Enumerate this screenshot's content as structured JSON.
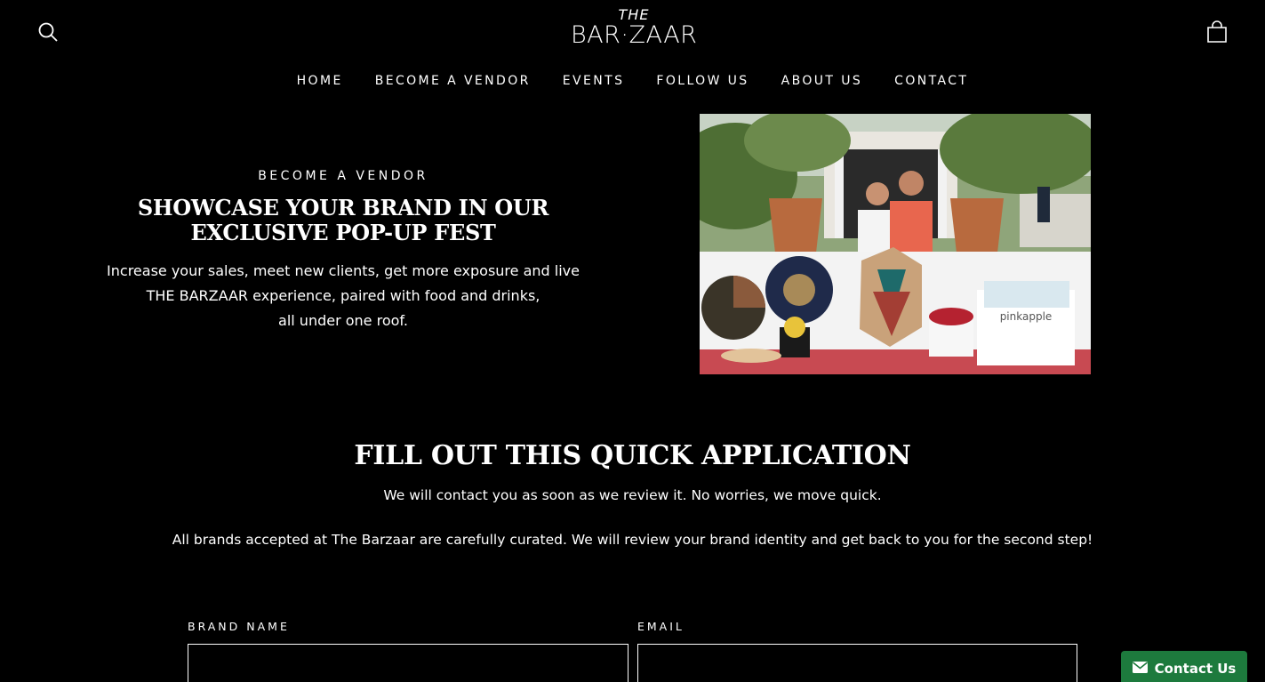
{
  "header": {
    "logo": {
      "the": "THE",
      "name": "BAR·ZAAR"
    },
    "search_icon": "search-icon",
    "cart_icon": "cart-icon"
  },
  "nav": {
    "items": [
      "HOME",
      "BECOME A VENDOR",
      "EVENTS",
      "FOLLOW US",
      "ABOUT US",
      "CONTACT"
    ]
  },
  "hero": {
    "eyebrow": "BECOME A VENDOR",
    "title_line1": "SHOWCASE YOUR BRAND IN OUR",
    "title_line2": "EXCLUSIVE POP-UP FEST",
    "body_line1": "Increase your sales, meet new clients, get more exposure and live",
    "body_line2": "THE BARZAAR experience, paired with food and drinks,",
    "body_line3": "all under one roof.",
    "photo_sign": "pinkapple"
  },
  "application": {
    "title": "FILL OUT THIS QUICK APPLICATION",
    "subtitle": "We will contact you as soon as we review it. No worries, we move quick.",
    "note": "All brands accepted at The Barzaar are carefully curated. We will review your brand identity and get back to you for the second step!",
    "fields": {
      "brand_label": "BRAND NAME",
      "brand_value": "",
      "email_label": "EMAIL",
      "email_value": ""
    }
  },
  "contact_widget": {
    "label": "Contact Us",
    "icon": "envelope-icon",
    "color": "#1d7a3d"
  }
}
